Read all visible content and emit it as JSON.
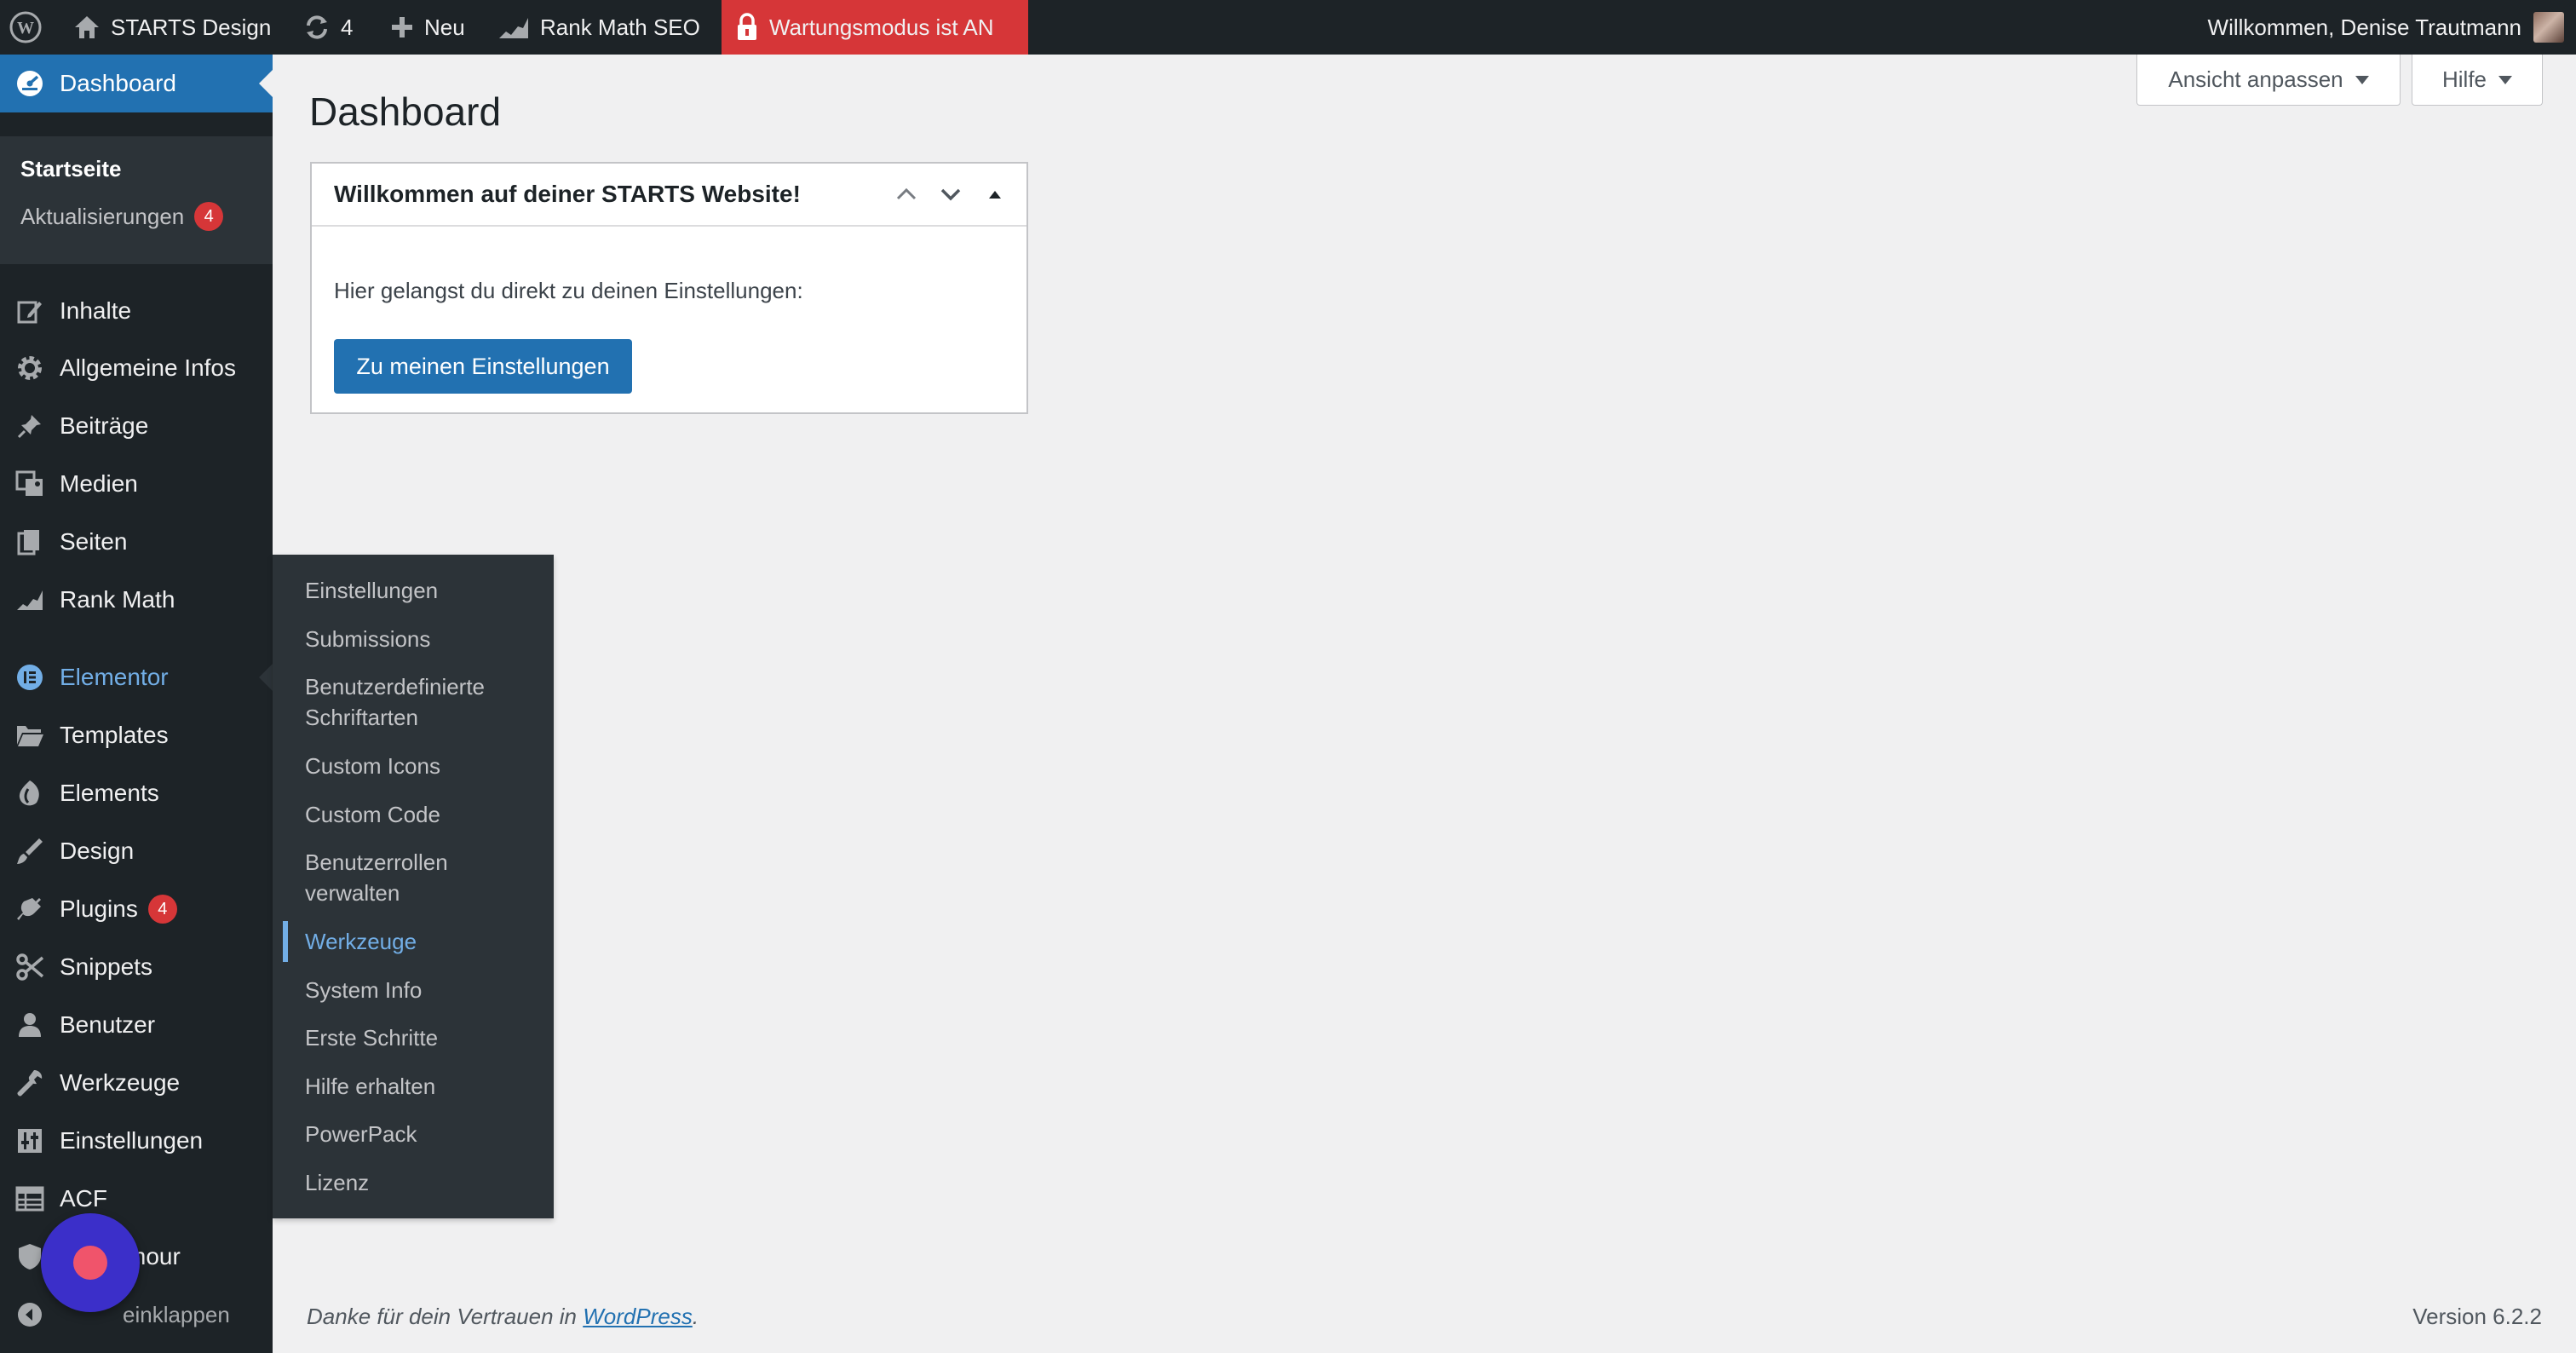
{
  "admin_bar": {
    "site_name": "STARTS Design",
    "updates_count": "4",
    "new_label": "Neu",
    "rank_math_label": "Rank Math SEO",
    "maintenance_label": "Wartungsmodus ist AN",
    "greeting": "Willkommen, Denise Trautmann",
    "icons": [
      "wordpress-logo-icon",
      "home-icon",
      "updates-icon",
      "plus-icon",
      "rank-math-icon",
      "lock-icon",
      "avatar"
    ],
    "maintenance_color": "#d63638"
  },
  "sidebar": {
    "dashboard_label": "Dashboard",
    "dashboard_submenu": {
      "home_label": "Startseite",
      "updates_label": "Aktualisierungen",
      "updates_badge": "4"
    },
    "items": [
      {
        "label": "Inhalte",
        "icon": "edit-icon"
      },
      {
        "label": "Allgemeine Infos",
        "icon": "gear-icon"
      },
      {
        "label": "Beiträge",
        "icon": "pin-icon"
      },
      {
        "label": "Medien",
        "icon": "media-icon"
      },
      {
        "label": "Seiten",
        "icon": "pages-icon"
      },
      {
        "label": "Rank Math",
        "icon": "rank-math-icon"
      },
      {
        "label": "Elementor",
        "icon": "elementor-icon"
      },
      {
        "label": "Templates",
        "icon": "folder-icon"
      },
      {
        "label": "Elements",
        "icon": "elements-icon"
      },
      {
        "label": "Design",
        "icon": "brush-icon"
      },
      {
        "label": "Plugins",
        "icon": "plugin-icon",
        "badge": "4"
      },
      {
        "label": "Snippets",
        "icon": "scissors-icon"
      },
      {
        "label": "Benutzer",
        "icon": "user-icon"
      },
      {
        "label": "Werkzeuge",
        "icon": "wrench-icon"
      },
      {
        "label": "Einstellungen",
        "icon": "sliders-icon"
      },
      {
        "label": "ACF",
        "icon": "table-icon"
      },
      {
        "label": "mour",
        "icon": "shield-icon"
      },
      {
        "label": "einklappen",
        "icon": "collapse-icon"
      }
    ],
    "current_color": "#2271b1",
    "hover_color": "#72aee6"
  },
  "flyout": {
    "items": [
      "Einstellungen",
      "Submissions",
      "Benutzerdefinierte Schriftarten",
      "Custom Icons",
      "Custom Code",
      "Benutzerrollen verwalten",
      "Werkzeuge",
      "System Info",
      "Erste Schritte",
      "Hilfe erhalten",
      "PowerPack",
      "Lizenz"
    ],
    "active_item": "Werkzeuge"
  },
  "screen_meta": {
    "screen_options_label": "Ansicht anpassen",
    "help_label": "Hilfe"
  },
  "main": {
    "title": "Dashboard",
    "welcome_box": {
      "heading": "Willkommen auf deiner STARTS Website!",
      "text": "Hier gelangst du direkt zu deinen Einstellungen:",
      "button_label": "Zu meinen Einstellungen"
    }
  },
  "footer": {
    "thanks_prefix": "Danke für dein Vertrauen in ",
    "thanks_link": "WordPress",
    "thanks_suffix": ".",
    "version": "Version 6.2.2"
  }
}
